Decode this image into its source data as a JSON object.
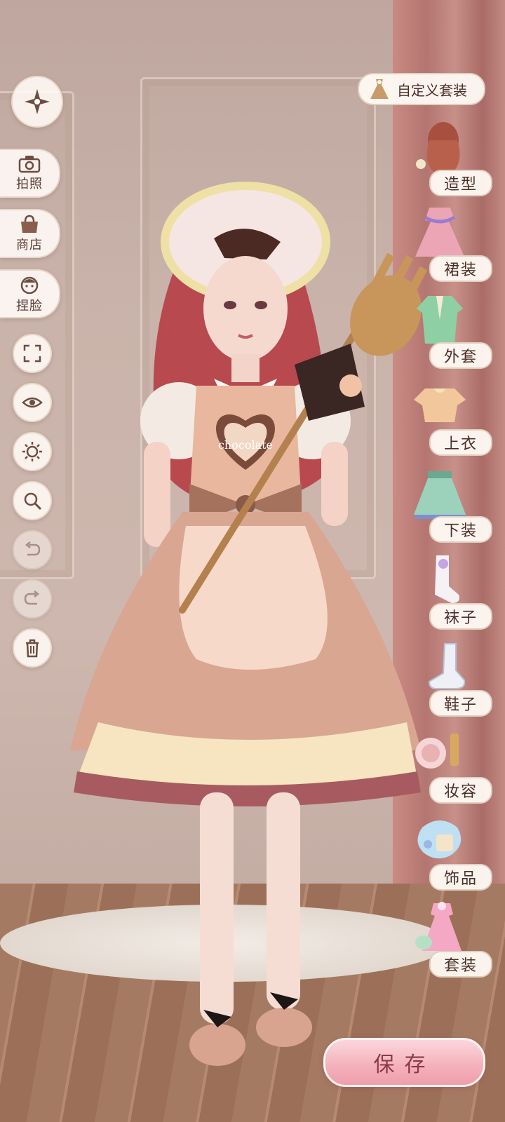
{
  "actions": {
    "camera_label": "拍照",
    "shop_label": "商店",
    "face_label": "捏脸"
  },
  "custom_outfit": {
    "label": "自定义套装"
  },
  "categories": [
    {
      "label": "造型"
    },
    {
      "label": "裙装"
    },
    {
      "label": "外套"
    },
    {
      "label": "上衣"
    },
    {
      "label": "下装"
    },
    {
      "label": "袜子"
    },
    {
      "label": "鞋子"
    },
    {
      "label": "妆容"
    },
    {
      "label": "饰品"
    },
    {
      "label": "套装"
    }
  ],
  "outfit": {
    "apron_text": "chocolate"
  },
  "save_label": "保存",
  "colors": {
    "accent": "#f4b0ba",
    "label_text": "#4b3029"
  }
}
